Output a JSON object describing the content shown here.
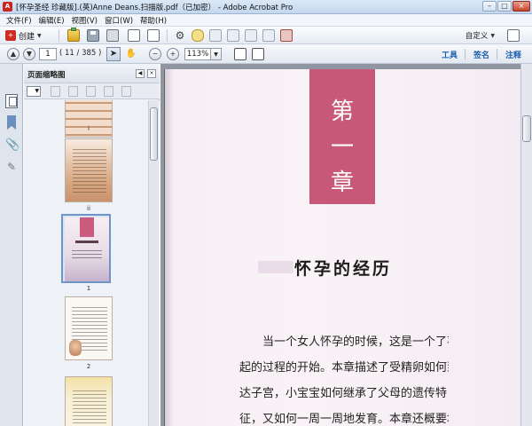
{
  "window": {
    "title": "[怀孕圣经 珍藏版].(英)Anne Deans.扫描版.pdf（已加密） - Adobe Acrobat Pro",
    "minimize": "–",
    "maximize": "□",
    "close": "×"
  },
  "menu": [
    "文件(F)",
    "编辑(E)",
    "视图(V)",
    "窗口(W)",
    "帮助(H)"
  ],
  "toolbar": {
    "create_label": "创建",
    "customize_label": "自定义"
  },
  "nav": {
    "current_page": "1",
    "page_total": "( 11 / 385 )",
    "zoom": "113%",
    "tools_link": "工具",
    "sign_link": "签名",
    "comment_link": "注释"
  },
  "thumbnails": {
    "panel_title": "页面缩略图",
    "items": [
      {
        "label": ""
      },
      {
        "label": "i"
      },
      {
        "label": "ii"
      },
      {
        "label": "1"
      },
      {
        "label": "2"
      }
    ]
  },
  "document": {
    "chapter_chars": [
      "第",
      "一",
      "章"
    ],
    "heading": "怀孕的经历",
    "body_lines": [
      "当一个女人怀孕的时候，这是一个了不",
      "起的过程的开始。本章描述了受精卵如何到",
      "达子宫，小宝宝如何继承了父母的遗传特",
      "征，又如何一周一周地发育。本章还概要地"
    ]
  },
  "colors": {
    "chapter_band": "#c85878",
    "link_blue": "#1d5fae",
    "thumb_selection": "#6f95c8"
  }
}
